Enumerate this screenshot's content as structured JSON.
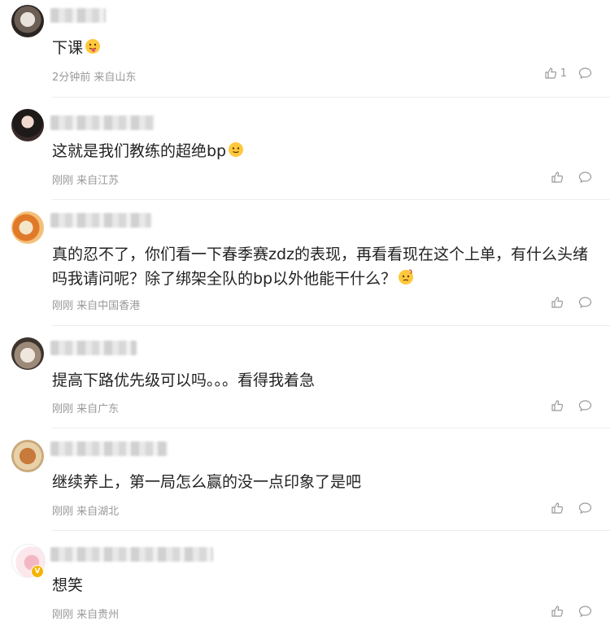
{
  "comments": [
    {
      "text": "下课",
      "time": "2分钟前",
      "location": "来自山东",
      "likes": "1"
    },
    {
      "text": "这就是我们教练的超绝bp",
      "time": "刚刚",
      "location": "来自江苏",
      "likes": ""
    },
    {
      "text": "真的忍不了，你们看一下春季赛zdz的表现，再看看现在这个上单，有什么头绪吗我请问呢？除了绑架全队的bp以外他能干什么？",
      "time": "刚刚",
      "location": "来自中国香港",
      "likes": ""
    },
    {
      "text": "提高下路优先级可以吗。。。看得我着急",
      "time": "刚刚",
      "location": "来自广东",
      "likes": ""
    },
    {
      "text": "继续养上，第一局怎么赢的没一点印象了是吧",
      "time": "刚刚",
      "location": "来自湖北",
      "likes": ""
    },
    {
      "text": "想笑",
      "time": "刚刚",
      "location": "来自贵州",
      "likes": ""
    }
  ],
  "colors": {
    "text": "#222222",
    "meta": "#999999",
    "divider": "#ededed",
    "vip_badge": "#f5b400"
  }
}
